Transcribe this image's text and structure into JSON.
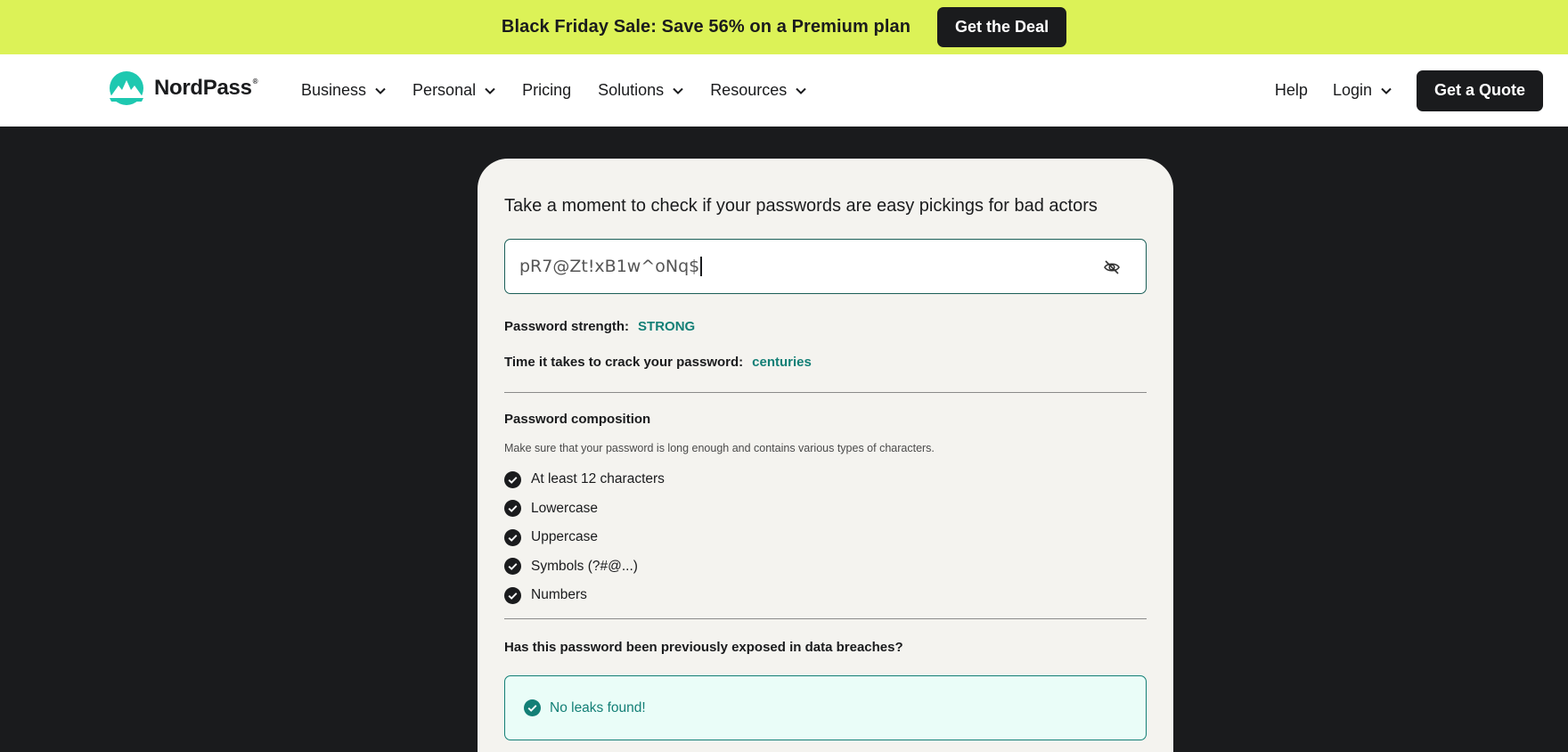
{
  "promo": {
    "text": "Black Friday Sale: Save 56% on a Premium plan",
    "button": "Get the Deal"
  },
  "nav": {
    "logo_text": "NordPass",
    "logo_mark": "®",
    "menu": [
      {
        "label": "Business",
        "dropdown": true
      },
      {
        "label": "Personal",
        "dropdown": true
      },
      {
        "label": "Pricing",
        "dropdown": false
      },
      {
        "label": "Solutions",
        "dropdown": true
      },
      {
        "label": "Resources",
        "dropdown": true
      }
    ],
    "help": "Help",
    "login": "Login",
    "quote_button": "Get a Quote"
  },
  "checker": {
    "heading": "Take a moment to check if your passwords are easy pickings for bad actors",
    "password_value": "pR7@Zt!xB1w^oNq$",
    "strength_label": "Password strength:",
    "strength_value": "STRONG",
    "crack_label": "Time it takes to crack your password:",
    "crack_value": "centuries",
    "composition_title": "Password composition",
    "composition_desc": "Make sure that your password is long enough and contains various types of characters.",
    "checks": [
      "At least 12 characters",
      "Lowercase",
      "Uppercase",
      "Symbols (?#@...)",
      "Numbers"
    ],
    "breach_question": "Has this password been previously exposed in data breaches?",
    "leak_result": "No leaks found!"
  },
  "colors": {
    "promo_bg": "#dcf257",
    "accent_teal": "#137f76",
    "page_dark": "#1a1b1d",
    "card_bg": "#f4f3ef",
    "leak_bg": "#eafdf8"
  }
}
